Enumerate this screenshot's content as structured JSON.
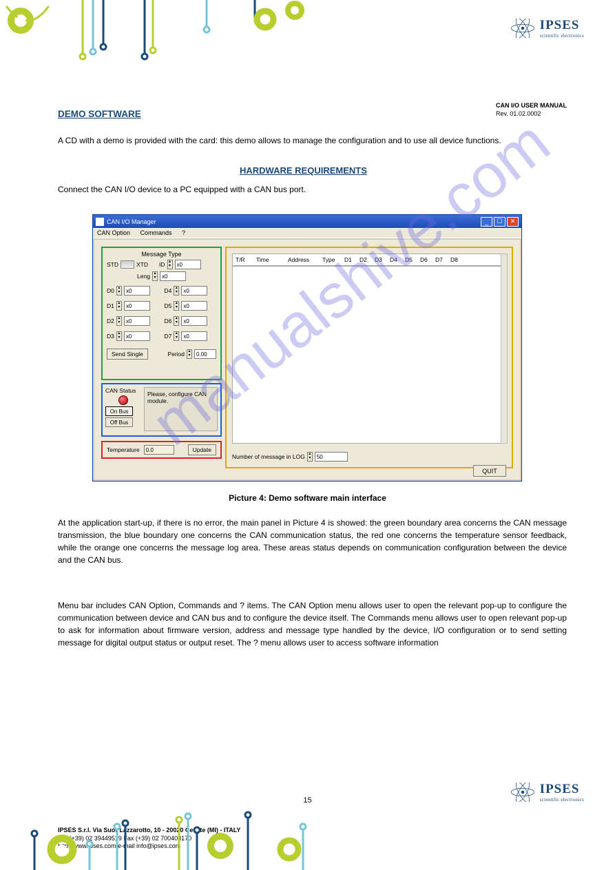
{
  "logo": {
    "name": "IPSES",
    "tag": "scientific electronics"
  },
  "docinfo": {
    "title_label": "",
    "title": "CAN I/O USER MANUAL",
    "rev_label": "Rev.",
    "rev": "01.02.0002"
  },
  "section": "DEMO SOFTWARE",
  "intro": "A CD with a demo is provided with the card: this demo allows to manage the configuration and to use all device functions.",
  "subsection": "HARDWARE REQUIREMENTS",
  "subsection_text": "Connect the CAN I/O device to a PC equipped with a CAN bus port.",
  "window": {
    "title": "CAN I/O Manager",
    "menus": [
      "CAN Option",
      "Commands",
      "?"
    ],
    "msg": {
      "header": "Message Type",
      "std": "STD",
      "xtd": "XTD",
      "id_lbl": "ID",
      "id": "x0",
      "leng_lbl": "Leng",
      "leng": "x0",
      "dlabels": [
        "D0",
        "D1",
        "D2",
        "D3",
        "D4",
        "D5",
        "D6",
        "D7"
      ],
      "dval": "x0",
      "send": "Send Single",
      "period_lbl": "Period",
      "period": "0.00"
    },
    "status": {
      "label": "CAN Status",
      "onbus": "On Bus",
      "offbus": "Off Bus",
      "msg": "Please, configure CAN module."
    },
    "temp": {
      "label": "Temperature",
      "val": "0.0",
      "update": "Update"
    },
    "log": {
      "cols": [
        "T/R",
        "Time",
        "Address",
        "Type",
        "D1",
        "D2",
        "D3",
        "D4",
        "D5",
        "D6",
        "D7",
        "D8"
      ],
      "foot_lbl": "Number of message in LOG",
      "foot_val": "50"
    },
    "quit": "QUIT"
  },
  "caption": "Picture 4: Demo software main interface",
  "p1": "At the application start-up, if there is no error, the main panel in Picture 4 is showed: the green boundary area concerns the CAN message transmission, the blue boundary one concerns the CAN communication status, the red one concerns the temperature sensor feedback, while the orange one concerns the message log area. These areas status depends on communication configuration between the device and the CAN bus.",
  "p2": "Menu bar includes CAN Option, Commands and ? items. The CAN Option menu allows user to open the relevant pop-up to configure the communication between device and CAN bus and to configure the device itself. The Commands menu allows user to open relevant pop-up to ask for information about firmware version, address and message type handled by the device, I/O configuration or to send setting message for digital output status or output reset. The ? menu allows user to access software information",
  "watermark": "manualshive.com",
  "pageno": "15",
  "footer": {
    "l1": "IPSES S.r.l. Via Suor Lazzarotto, 10 - 20020 Cesate (MI) - ITALY",
    "l2": "Tel. (+39) 02 39449519   Fax (+39) 02 700403170",
    "l3": "http://www.ipses.com    e-mail info@ipses.com"
  }
}
